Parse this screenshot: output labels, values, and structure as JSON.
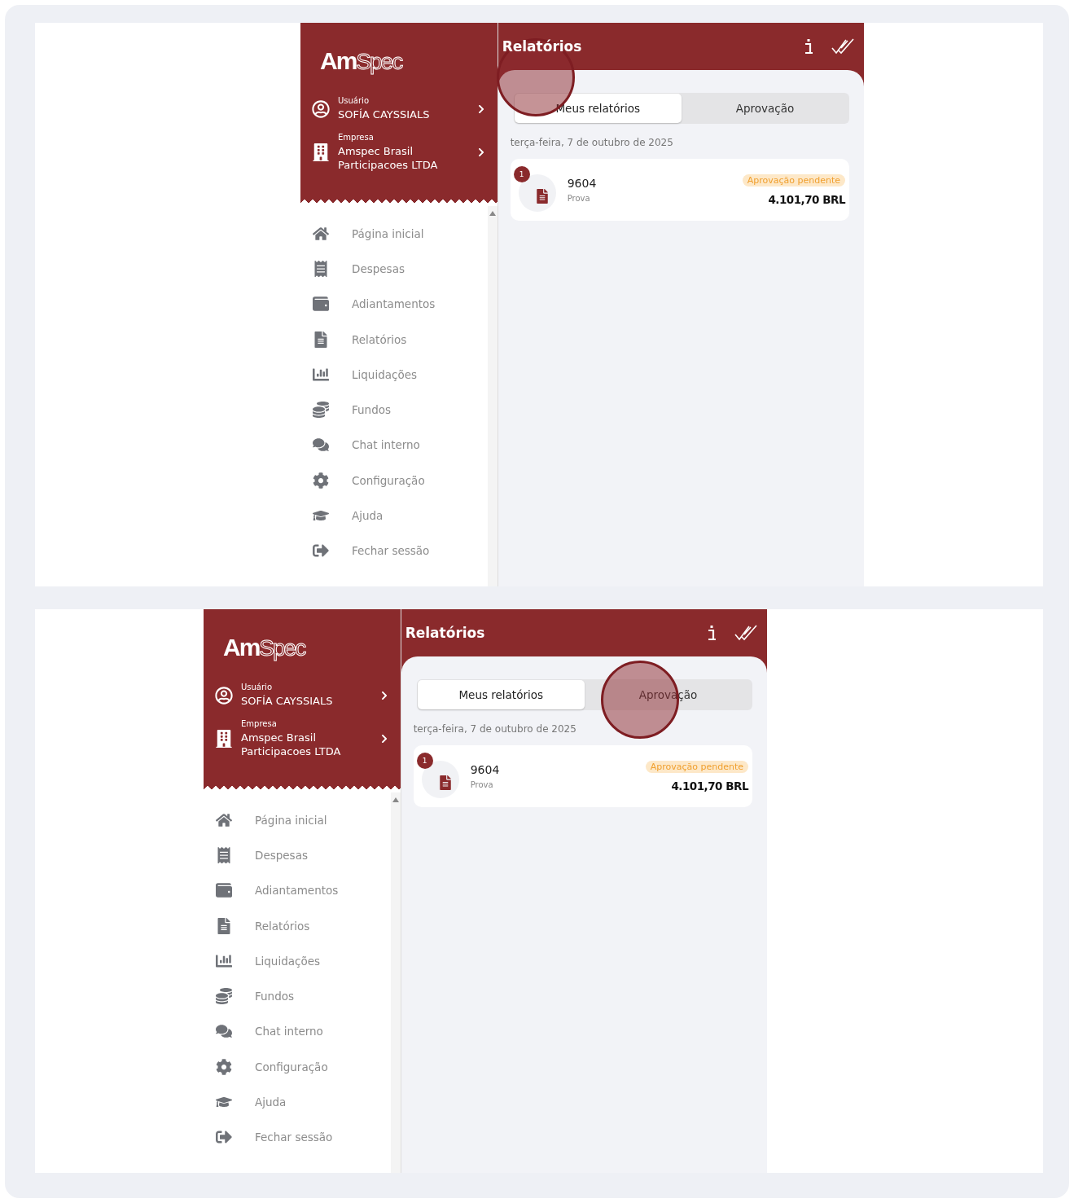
{
  "frames": [
    {
      "logo": [
        "Am",
        "Spec"
      ],
      "user": {
        "label": "Usuário",
        "name": "SOFÍA CAYSSIALS"
      },
      "company": {
        "label": "Empresa",
        "name": "Amspec Brasil Participacoes LTDA"
      },
      "menu": [
        "Página inicial",
        "Despesas",
        "Adiantamentos",
        "Relatórios",
        "Liquidações",
        "Fundos",
        "Chat interno",
        "Configuração",
        "Ajuda",
        "Fechar sessão"
      ],
      "title": "Relatórios",
      "tabs": [
        {
          "label": "Meus relatórios",
          "selected": true,
          "tapped": true
        },
        {
          "label": "Aprovação",
          "selected": false,
          "tapped": false
        }
      ],
      "date": "terça-feira, 7 de outubro de 2025",
      "reports": [
        {
          "badge": "1",
          "number": "9604",
          "name": "Prova",
          "status": "Aprovação pendente",
          "amount": "4.101,70 BRL"
        }
      ]
    },
    {
      "logo": [
        "Am",
        "Spec"
      ],
      "user": {
        "label": "Usuário",
        "name": "SOFÍA CAYSSIALS"
      },
      "company": {
        "label": "Empresa",
        "name": "Amspec Brasil Participacoes LTDA"
      },
      "menu": [
        "Página inicial",
        "Despesas",
        "Adiantamentos",
        "Relatórios",
        "Liquidações",
        "Fundos",
        "Chat interno",
        "Configuração",
        "Ajuda",
        "Fechar sessão"
      ],
      "title": "Relatórios",
      "tabs": [
        {
          "label": "Meus relatórios",
          "selected": true,
          "tapped": false
        },
        {
          "label": "Aprovação",
          "selected": false,
          "tapped": true
        }
      ],
      "date": "terça-feira, 7 de outubro de 2025",
      "reports": [
        {
          "badge": "1",
          "number": "9604",
          "name": "Prova",
          "status": "Aprovação pendente",
          "amount": "4.101,70 BRL"
        }
      ]
    }
  ]
}
